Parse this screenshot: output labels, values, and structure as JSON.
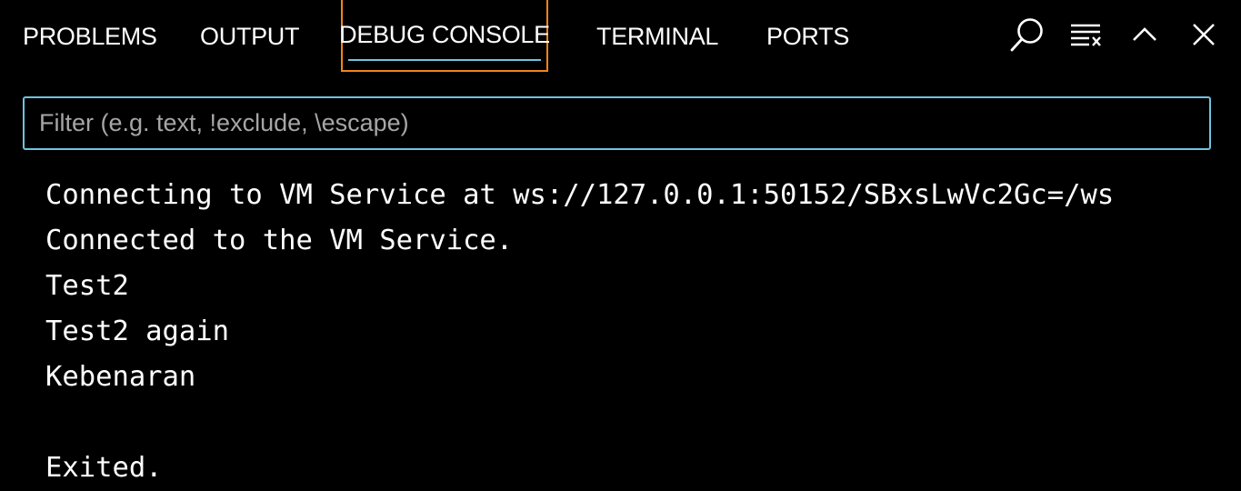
{
  "tabs": [
    {
      "label": "PROBLEMS",
      "active": false
    },
    {
      "label": "OUTPUT",
      "active": false
    },
    {
      "label": "DEBUG CONSOLE",
      "active": true
    },
    {
      "label": "TERMINAL",
      "active": false
    },
    {
      "label": "PORTS",
      "active": false
    }
  ],
  "actions": {
    "search_icon": "search-icon",
    "clear_icon": "clear-console-icon",
    "collapse_icon": "chevron-up-icon",
    "close_icon": "close-icon"
  },
  "filter": {
    "value": "",
    "placeholder": "Filter (e.g. text, !exclude, \\escape)"
  },
  "console": {
    "lines": [
      "Connecting to VM Service at ws://127.0.0.1:50152/SBxsLwVc2Gc=/ws",
      "Connected to the VM Service.",
      "Test2",
      "Test2 again",
      "Kebenaran",
      "",
      "Exited."
    ]
  },
  "colors": {
    "background": "#000000",
    "text": "#ffffff",
    "focus_border": "#f38518",
    "active_underline": "#6fc3df",
    "input_border": "#6fc3df",
    "placeholder": "#a6a6a6"
  }
}
